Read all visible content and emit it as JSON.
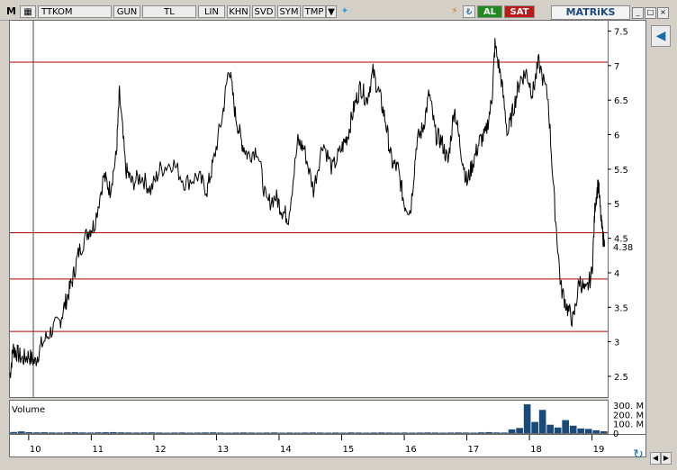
{
  "toolbar": {
    "menu_label": "M",
    "symbol": "TTKOM",
    "period": "GUN",
    "currency": "TL",
    "scale": "LIN",
    "btn_khn": "KHN",
    "btn_svd": "SVD",
    "btn_sym": "SYM",
    "btn_tmp": "TMP",
    "buy_label": "AL",
    "sell_label": "SAT",
    "brand": "MATRiKS"
  },
  "colors": {
    "price_line": "#000000",
    "support_lines": "#b00000",
    "volume_bars": "#1a4a7a",
    "buy": "#1e8c1e",
    "sell": "#c01818"
  },
  "chart_data": {
    "type": "line",
    "title": "",
    "xlabel": "",
    "ylabel": "",
    "x_ticks": [
      "10",
      "11",
      "12",
      "13",
      "14",
      "15",
      "16",
      "17",
      "18",
      "19"
    ],
    "y_ticks": [
      2.5,
      3,
      3.5,
      4,
      4.5,
      5,
      5.5,
      6,
      6.5,
      7,
      7.5
    ],
    "ylim": [
      2.2,
      7.65
    ],
    "xlim": [
      9.7,
      19.25
    ],
    "last_value": "4.38",
    "horizontal_lines": [
      7.05,
      4.58,
      3.91,
      3.15
    ],
    "cursor_x": 9.35,
    "series": [
      {
        "values_x": [
          9.7,
          9.75,
          9.8,
          9.9,
          10.0,
          10.1,
          10.2,
          10.35,
          10.5,
          10.6,
          10.7,
          10.8,
          10.95,
          11.05,
          11.2,
          11.3,
          11.4,
          11.45,
          11.55,
          11.65,
          11.8,
          11.95,
          12.1,
          12.3,
          12.5,
          12.7,
          12.85,
          12.95,
          13.1,
          13.2,
          13.3,
          13.4,
          13.5,
          13.65,
          13.8,
          13.95,
          14.05,
          14.15,
          14.3,
          14.4,
          14.55,
          14.7,
          14.85,
          15.0,
          15.1,
          15.2,
          15.3,
          15.4,
          15.5,
          15.6,
          15.7,
          15.8,
          15.9,
          16.0,
          16.1,
          16.2,
          16.3,
          16.4,
          16.5,
          16.6,
          16.7,
          16.8,
          16.9,
          17.0,
          17.1,
          17.2,
          17.3,
          17.4,
          17.45,
          17.55,
          17.65,
          17.75,
          17.85,
          17.95,
          18.05,
          18.15,
          18.3,
          18.4,
          18.5,
          18.6,
          18.7,
          18.8,
          18.9,
          19.0,
          19.05,
          19.1,
          19.15,
          19.2
        ],
        "values": [
          2.5,
          2.9,
          2.85,
          2.75,
          2.8,
          2.7,
          2.95,
          3.15,
          3.3,
          3.6,
          3.9,
          4.3,
          4.6,
          4.7,
          5.4,
          5.2,
          5.7,
          6.6,
          5.5,
          5.3,
          5.4,
          5.2,
          5.5,
          5.6,
          5.3,
          5.4,
          5.2,
          5.6,
          6.3,
          7.0,
          6.3,
          5.9,
          5.7,
          5.8,
          5.0,
          5.1,
          4.9,
          4.8,
          5.9,
          5.8,
          5.2,
          5.9,
          5.5,
          5.8,
          6.0,
          6.4,
          6.7,
          6.5,
          6.9,
          6.6,
          6.2,
          5.6,
          5.5,
          5.0,
          4.9,
          5.9,
          6.1,
          6.6,
          6.0,
          5.9,
          5.6,
          6.4,
          5.8,
          5.3,
          5.6,
          5.9,
          6.0,
          6.5,
          7.3,
          6.8,
          6.0,
          6.4,
          6.8,
          6.9,
          6.6,
          7.05,
          6.5,
          5.0,
          3.8,
          3.5,
          3.3,
          3.9,
          3.7,
          4.0,
          5.0,
          5.3,
          4.7,
          4.38
        ]
      }
    ],
    "volume": {
      "label": "Volume",
      "ticks": [
        "300. M",
        "200. M",
        "100. M",
        "0"
      ],
      "ylim": [
        0,
        330
      ],
      "values": [
        12,
        18,
        10,
        8,
        9,
        7,
        6,
        8,
        9,
        7,
        6,
        8,
        9,
        10,
        8,
        7,
        6,
        7,
        8,
        6,
        5,
        6,
        7,
        5,
        6,
        7,
        8,
        6,
        5,
        6,
        7,
        6,
        5,
        6,
        7,
        5,
        6,
        5,
        6,
        7,
        6,
        5,
        6,
        5,
        7,
        6,
        5,
        6,
        7,
        6,
        5,
        6,
        5,
        6,
        7,
        6,
        5,
        6,
        7,
        6,
        5,
        8,
        10,
        7,
        6,
        40,
        55,
        310,
        120,
        250,
        90,
        60,
        140,
        80,
        50,
        45,
        30,
        20
      ]
    }
  }
}
